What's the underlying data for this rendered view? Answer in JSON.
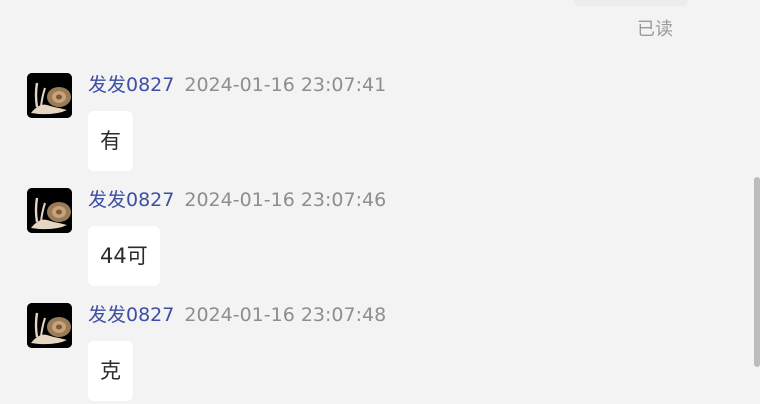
{
  "read_status": "已读",
  "messages": [
    {
      "sender": "发发0827",
      "timestamp": "2024-01-16 23:07:41",
      "text": "有",
      "avatar_icon": "snail-avatar-icon"
    },
    {
      "sender": "发发0827",
      "timestamp": "2024-01-16 23:07:46",
      "text": "44可",
      "avatar_icon": "snail-avatar-icon"
    },
    {
      "sender": "发发0827",
      "timestamp": "2024-01-16 23:07:48",
      "text": "克",
      "avatar_icon": "snail-avatar-icon"
    }
  ],
  "colors": {
    "background": "#f3f3f3",
    "sender_name": "#3d4fa3",
    "timestamp": "#8e8e8e",
    "bubble": "#ffffff",
    "read_status": "#9a9a9a"
  }
}
